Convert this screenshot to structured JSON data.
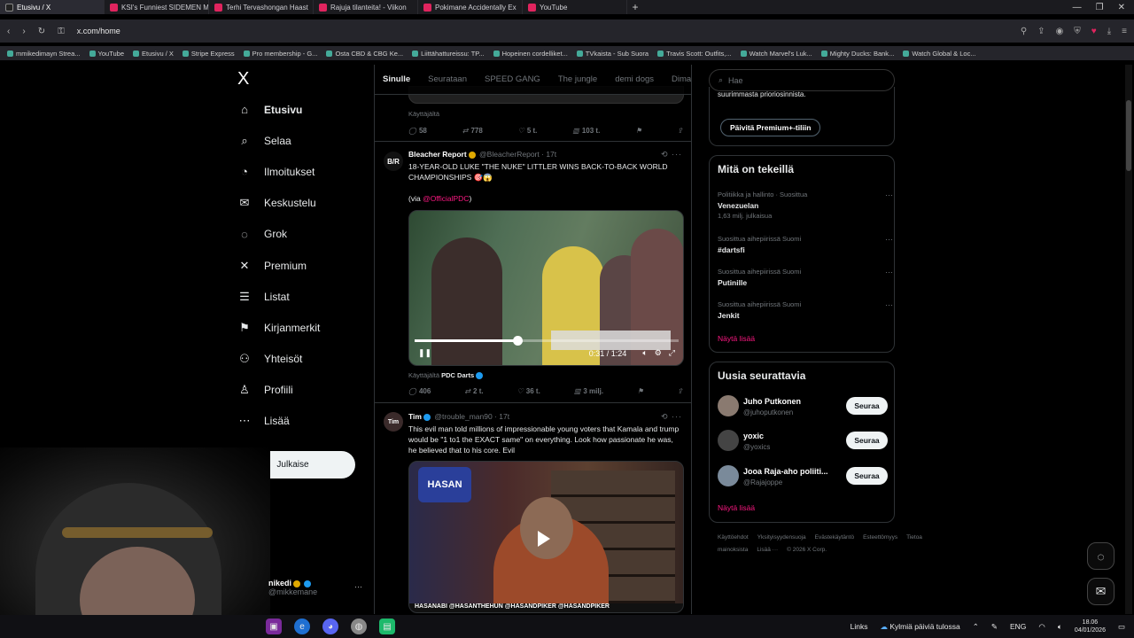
{
  "browser": {
    "tabs": [
      {
        "label": "Etusivu / X",
        "active": true
      },
      {
        "label": "KSI's Funniest SIDEMEN M",
        "active": false
      },
      {
        "label": "Terhi Tervashongan Haast",
        "active": false
      },
      {
        "label": "Rajuja tilanteita! - Viikon",
        "active": false
      },
      {
        "label": "Pokimane Accidentally Ex",
        "active": false
      },
      {
        "label": "YouTube",
        "active": false
      }
    ],
    "url": "x.com/home",
    "bookmarks": [
      "mmikedimayn Strea...",
      "YouTube",
      "Etusivu / X",
      "Stripe Express",
      "Pro membership - G...",
      "Osta CBD & CBG Ke...",
      "Liittähattureissu: TP...",
      "Hopeinen cordelliket...",
      "TVkaista - Sub Suora",
      "Travis Scott: Outfits,...",
      "Watch Marvel's Luk...",
      "Mighty Ducks: Bank...",
      "Watch Global & Loc..."
    ]
  },
  "nav": {
    "logo": "X",
    "items": [
      {
        "label": "Etusivu",
        "icon": "home-icon",
        "glyph": "⌂",
        "active": true
      },
      {
        "label": "Selaa",
        "icon": "search-icon",
        "glyph": "⌕",
        "active": false
      },
      {
        "label": "Ilmoitukset",
        "icon": "bell-icon",
        "glyph": "◔",
        "active": false
      },
      {
        "label": "Keskustelu",
        "icon": "mail-icon",
        "glyph": "✉",
        "active": false
      },
      {
        "label": "Grok",
        "icon": "grok-icon",
        "glyph": "◌",
        "active": false
      },
      {
        "label": "Premium",
        "icon": "x-premium-icon",
        "glyph": "✕",
        "active": false
      },
      {
        "label": "Listat",
        "icon": "list-icon",
        "glyph": "☰",
        "active": false
      },
      {
        "label": "Kirjanmerkit",
        "icon": "bookmark-icon",
        "glyph": "⚑",
        "active": false
      },
      {
        "label": "Yhteisöt",
        "icon": "communities-icon",
        "glyph": "⚇",
        "active": false
      },
      {
        "label": "Profiili",
        "icon": "profile-icon",
        "glyph": "♙",
        "active": false
      },
      {
        "label": "Lisää",
        "icon": "more-circle-icon",
        "glyph": "⋯",
        "active": false
      }
    ],
    "post_button": "Julkaise",
    "account_name": "nikedi",
    "account_handle": "@mikkemane"
  },
  "feed": {
    "tabs": [
      "Sinulle",
      "Seurataan",
      "SPEED GANG",
      "The jungle",
      "demi dogs",
      "Dima's Di"
    ],
    "top_post": {
      "via": "Käyttäjältä",
      "replies": "58",
      "reposts": "778",
      "likes": "5 t.",
      "views": "103 t."
    },
    "posts": [
      {
        "avatar": "B/R",
        "author": "Bleacher Report",
        "handle": "@BleacherReport",
        "time": "17t",
        "text": "18-YEAR-OLD LUKE \"THE NUKE\" LITTLER WINS BACK-TO-BACK WORLD CHAMPIONSHIPS 🎯😱",
        "via_prefix": "(via ",
        "via_link": "@OfficialPDC",
        "via_suffix": ")",
        "video_time": "0:31 / 1:24",
        "video_progress": 0.39,
        "source_prefix": "Käyttäjältä",
        "source": "PDC Darts",
        "replies": "406",
        "reposts": "2 t.",
        "likes": "36 t.",
        "views": "3 milj."
      },
      {
        "avatar": "Tim",
        "author": "Tim",
        "handle": "@trouble_man90",
        "time": "17t",
        "text": "This evil man told millions of impressionable young voters that Kamala and trump would be \"1 to1 the EXACT same\" on everything. Look how passionate he was, he believed that to his core. Evil",
        "video_logo": "HASAN",
        "video_banner": "HASANABI  @HASANTHEHUN  @HASANDPIKER  @HASANDPIKER"
      }
    ]
  },
  "sidebar": {
    "search_placeholder": "Hae",
    "premium_text": "suurimmasta prioriosinnista.",
    "premium_button": "Päivitä Premium+-tiliin",
    "trends_title": "Mitä on tekeillä",
    "trends": [
      {
        "context": "Politiikka ja hallinto · Suosittua",
        "title": "Venezuelan",
        "count": "1,63 milj. julkaisua"
      },
      {
        "context": "Suosittua aihepiirissä Suomi",
        "title": "#dartsfi",
        "count": ""
      },
      {
        "context": "Suosittua aihepiirissä Suomi",
        "title": "Putinille",
        "count": ""
      },
      {
        "context": "Suosittua aihepiirissä Suomi",
        "title": "Jenkit",
        "count": ""
      }
    ],
    "show_more": "Näytä lisää",
    "follow_title": "Uusia seurattavia",
    "follow": [
      {
        "name": "Juho Putkonen",
        "handle": "@juhoputkonen",
        "button": "Seuraa"
      },
      {
        "name": "yoxic",
        "handle": "@yoxics",
        "button": "Seuraa"
      },
      {
        "name": "Jooa Raja-aho poliiti...",
        "handle": "@Rajajoppe",
        "button": "Seuraa"
      }
    ],
    "footer": [
      "Käyttöehdot",
      "Yksityisyydensuoja",
      "Evästekäytäntö",
      "Esteettömyys",
      "Tietoa mainoksista",
      "Lisää ···",
      "© 2026 X Corp."
    ]
  },
  "taskbar": {
    "links": "Links",
    "weather": "Kylmiä päiviä tulossa",
    "lang": "ENG",
    "time": "18.06",
    "date": "04/01/2026"
  }
}
